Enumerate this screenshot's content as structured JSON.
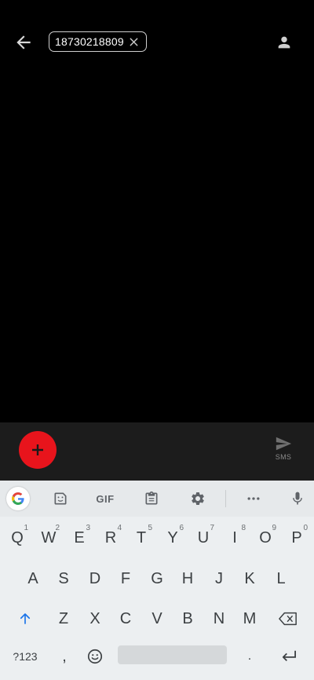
{
  "header": {
    "recipient_chip": "18730218809"
  },
  "compose": {
    "send_label": "SMS"
  },
  "keyboard": {
    "toolbar_gif_label": "GIF",
    "row1": [
      {
        "key": "Q",
        "hint": "1"
      },
      {
        "key": "W",
        "hint": "2"
      },
      {
        "key": "E",
        "hint": "3"
      },
      {
        "key": "R",
        "hint": "4"
      },
      {
        "key": "T",
        "hint": "5"
      },
      {
        "key": "Y",
        "hint": "6"
      },
      {
        "key": "U",
        "hint": "7"
      },
      {
        "key": "I",
        "hint": "8"
      },
      {
        "key": "O",
        "hint": "9"
      },
      {
        "key": "P",
        "hint": "0"
      }
    ],
    "row2": [
      "A",
      "S",
      "D",
      "F",
      "G",
      "H",
      "J",
      "K",
      "L"
    ],
    "row3": [
      "Z",
      "X",
      "C",
      "V",
      "B",
      "N",
      "M"
    ],
    "bottom": {
      "symbols_label": "?123",
      "comma": ",",
      "period": "."
    }
  },
  "colors": {
    "accent_red": "#e8141c",
    "background": "#000000",
    "compose_bar": "#1c1c1c",
    "keyboard_bg": "#eceff1"
  }
}
